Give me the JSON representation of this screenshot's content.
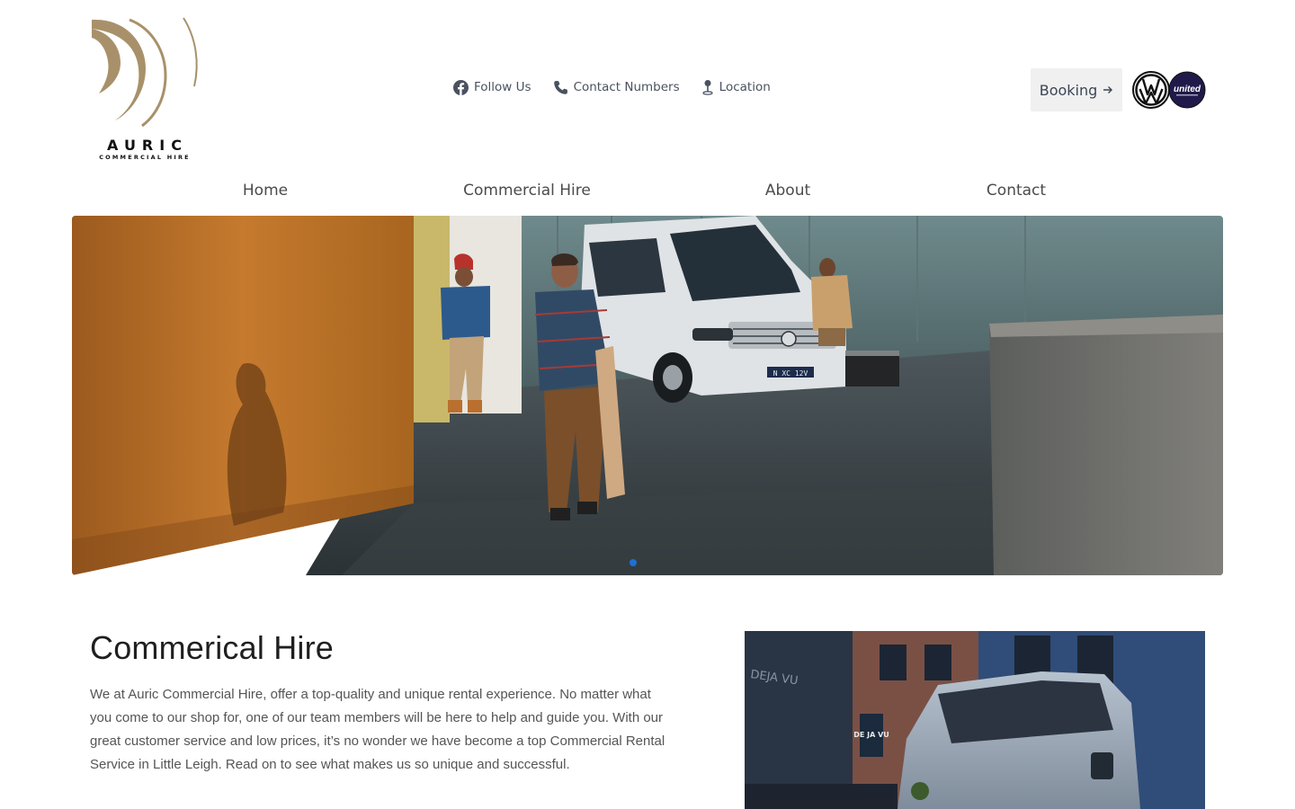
{
  "brand": {
    "name": "AURIC",
    "tagline": "COMMERCIAL HIRE",
    "logo_icon": "auric-logo-arcs"
  },
  "top_links": [
    {
      "label": "Follow Us",
      "icon": "facebook-icon"
    },
    {
      "label": "Contact Numbers",
      "icon": "phone-icon"
    },
    {
      "label": "Location",
      "icon": "map-pin-icon"
    }
  ],
  "booking": {
    "label": "Booking",
    "icon": "arrow-right-icon"
  },
  "partner_logos": {
    "vw": "VW",
    "united": "united"
  },
  "nav": [
    {
      "label": "Home"
    },
    {
      "label": "Commercial Hire"
    },
    {
      "label": "About"
    },
    {
      "label": "Contact"
    }
  ],
  "hero": {
    "plate": "N XC 12V",
    "active_slide": 1,
    "slide_count": 1
  },
  "section": {
    "title": "Commerical Hire",
    "body": "We at Auric Commercial Hire, offer a top-quality and unique rental experience. No matter what you come to our shop for, one of our team members will be here to help and guide you. With our great customer service and low prices, it’s no wonder we have become a top Commercial Rental Service in Little Leigh. Read on to see what makes us so unique and successful."
  },
  "side_image": {
    "sign_text_1": "DEJA VU",
    "sign_text_2": "DE JA VU"
  },
  "colors": {
    "gold": "#a8916a",
    "dark_text": "#1f1f1f",
    "dot_blue": "#1e6fd9",
    "button_bg": "#f0f0f0"
  }
}
